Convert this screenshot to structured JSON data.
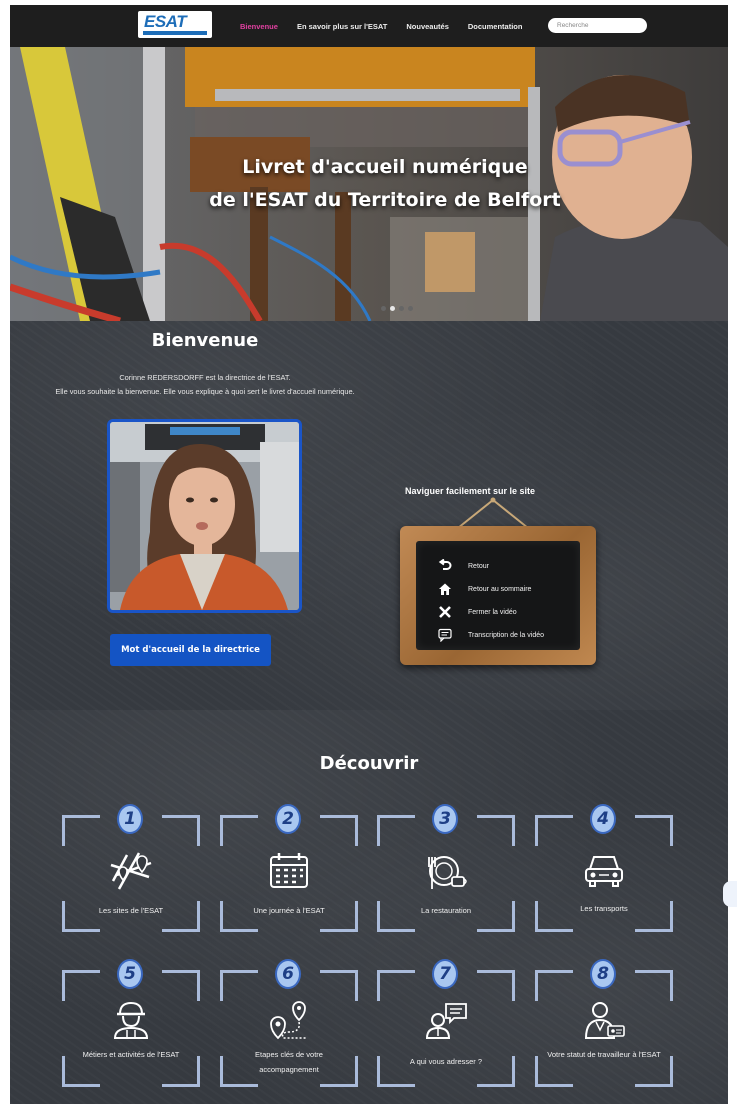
{
  "nav": {
    "logo_text": "ESAT",
    "links": [
      {
        "label": "Bienvenue",
        "active": true
      },
      {
        "label": "En savoir plus sur l'ESAT",
        "active": false
      },
      {
        "label": "Nouveautés",
        "active": false
      },
      {
        "label": "Documentation",
        "active": false
      }
    ],
    "search_placeholder": "Recherche"
  },
  "hero": {
    "title_line1": "Livret d'accueil numérique",
    "title_line2": "de l'ESAT du Territoire de Belfort",
    "slide_count": 4,
    "active_slide": 2
  },
  "welcome": {
    "title": "Bienvenue",
    "line1": "Corinne REDERSDORFF est la directrice de l'ESAT.",
    "line2": "Elle vous souhaite la bienvenue. Elle vous explique à quoi sert le livret d'accueil numérique.",
    "video_button": "Mot d'accueil de la directrice",
    "nav_help_title": "Naviguer facilement sur le site",
    "legend": [
      {
        "icon": "return-arrow-icon",
        "label": "Retour"
      },
      {
        "icon": "home-icon",
        "label": "Retour au sommaire"
      },
      {
        "icon": "close-icon",
        "label": "Fermer la vidéo"
      },
      {
        "icon": "transcript-icon",
        "label": "Transcription de la vidéo"
      }
    ]
  },
  "discover": {
    "title": "Découvrir",
    "cards": [
      {
        "number": "1",
        "icon": "map-icon",
        "label": "Les sites de l'ESAT"
      },
      {
        "number": "2",
        "icon": "calendar-icon",
        "label": "Une journée à l'ESAT"
      },
      {
        "number": "3",
        "icon": "restaurant-icon",
        "label": "La restauration"
      },
      {
        "number": "4",
        "icon": "car-icon",
        "label": "Les transports"
      },
      {
        "number": "5",
        "icon": "worker-icon",
        "label": "Métiers et activités de l'ESAT"
      },
      {
        "number": "6",
        "icon": "route-icon",
        "label": "Etapes clés de votre accompagnement"
      },
      {
        "number": "7",
        "icon": "contact-person-icon",
        "label": "A qui vous adresser ?"
      },
      {
        "number": "8",
        "icon": "worker-status-icon",
        "label": "Votre statut de travailleur à l'ESAT"
      }
    ]
  },
  "colors": {
    "nav_bg": "#1e1e1e",
    "active_link": "#e040a0",
    "chalkboard": "#363a40",
    "button_blue": "#1454c4",
    "frame_blue": "#aabbda"
  }
}
